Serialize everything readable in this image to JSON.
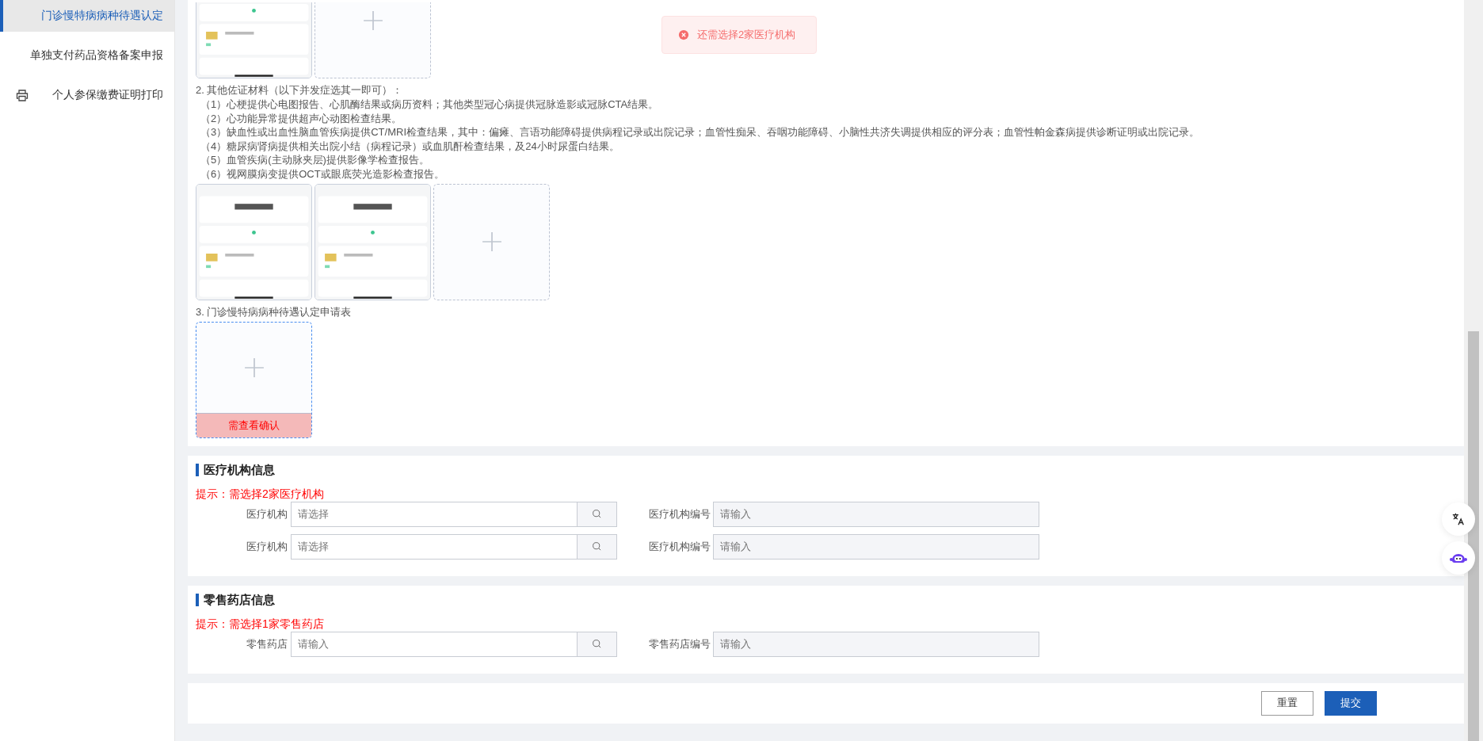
{
  "sidebar": {
    "items": [
      {
        "label": "门诊慢特病病种待遇认定",
        "selected": true,
        "kind": "plain"
      },
      {
        "label": "单独支付药品资格备案申报",
        "selected": false,
        "kind": "plain"
      },
      {
        "label": "个人参保缴费证明打印",
        "selected": false,
        "kind": "printer"
      }
    ]
  },
  "toast": {
    "message": "还需选择2家医疗机构"
  },
  "materials": [
    {
      "tiles": [
        {
          "kind": "picture"
        },
        {
          "kind": "add"
        }
      ]
    },
    {
      "heading": "2. 其他佐证材料（以下并发症选其一即可）：",
      "lines": [
        "（1）心梗提供心电图报告、心肌酶结果或病历资料；其他类型冠心病提供冠脉造影或冠脉CTA结果。",
        "（2）心功能异常提供超声心动图检查结果。",
        "（3）缺血性或出血性脑血管疾病提供CT/MRI检查结果，其中：偏瘫、言语功能障碍提供病程记录或出院记录；血管性痴呆、吞咽功能障碍、小脑性共济失调提供相应的评分表；血管性帕金森病提供诊断证明或出院记录。",
        "（4）糖尿病肾病提供相关出院小结（病程记录）或血肌酐检查结果，及24小时尿蛋白结果。",
        "（5）血管疾病(主动脉夹层)提供影像学检查报告。",
        "（6）视网膜病变提供OCT或眼底荧光造影检查报告。"
      ],
      "tiles": [
        {
          "kind": "picture"
        },
        {
          "kind": "picture"
        },
        {
          "kind": "add"
        }
      ]
    },
    {
      "heading": "3. 门诊慢特病病种待遇认定申请表",
      "tiles": [
        {
          "kind": "add",
          "caption": "需查看确认"
        }
      ]
    }
  ],
  "sections": [
    {
      "title": "医疗机构信息",
      "hint": "提示：需选择2家医疗机构",
      "rows": [
        {
          "label": "医疗机构",
          "placeholder": "请选择",
          "code_label": "医疗机构编号",
          "code_placeholder": "请输入"
        },
        {
          "label": "医疗机构",
          "placeholder": "请选择",
          "code_label": "医疗机构编号",
          "code_placeholder": "请输入"
        }
      ]
    },
    {
      "title": "零售药店信息",
      "hint": "提示：需选择1家零售药店",
      "rows": [
        {
          "label": "零售药店",
          "placeholder": "请输入",
          "code_label": "零售药店编号",
          "code_placeholder": "请输入"
        }
      ]
    }
  ],
  "actions": [
    {
      "label": "重置",
      "kind": "default"
    },
    {
      "label": "提交",
      "kind": "primary"
    }
  ]
}
